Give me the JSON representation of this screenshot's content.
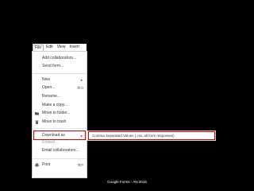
{
  "menubar": {
    "items": [
      {
        "label": "File"
      },
      {
        "label": "Edit"
      },
      {
        "label": "View"
      },
      {
        "label": "Insert"
      }
    ]
  },
  "file_menu": {
    "add_collaborators": "Add collaborators...",
    "send_form": "Send form...",
    "new": "New",
    "new_arrow": "►",
    "open": "Open...",
    "open_shortcut": "⌘O",
    "rename": "Rename...",
    "make_copy": "Make a copy...",
    "move_to_folder": "Move to folder...",
    "move_to_trash": "Move to trash",
    "download_as": "Download as",
    "download_arrow": "►",
    "embed": "Embed...",
    "email_collaborators": "Email collaborators...",
    "print": "Print",
    "print_shortcut": "⌘P"
  },
  "download_submenu": {
    "csv": "Comma Separated Values (.csv, all form responses)"
  },
  "caption": "Google Forms - AN 2015",
  "colors": {
    "background": "#000000",
    "menu_bg": "#ffffff",
    "highlight": "#d40000"
  },
  "icons": {
    "folder": "folder-icon",
    "trash": "trash-icon",
    "print": "print-icon"
  }
}
